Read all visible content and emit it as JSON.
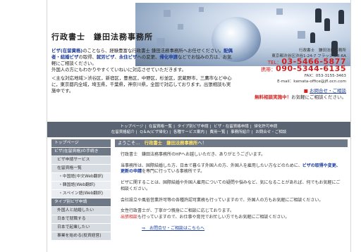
{
  "header": {
    "title": "行政書士　鎌田法務事務所",
    "intro": {
      "p1_a": "ビザ(在留資格)",
      "p1_b": "のことなら、経験豊富な行政書士 鎌田法務事務所へお任せください。",
      "p1_c": "配偶者・結婚ビザ",
      "p1_d": "の取得、",
      "p1_e": "就労ビザ",
      "p1_f": "、",
      "p1_g": "永住ビザ",
      "p1_h": "への変更、",
      "p1_i": "帰化申請",
      "p1_j": "などでお悩みの方は、お気軽にご相談ください。",
      "p1_k": "外国人の方にもわかりやすくていねいに対応させていただきます。",
      "p2": "＜主な対応地域＞渋谷区，新宿区，豊島区，中野区，杉並区，武蔵野市，三鷹市など中心に，東京都内全域，埼玉県，千葉県，神奈川県，全国で対応しております。出張相談も実施中です。"
    },
    "contact": {
      "office_line1": "行政書士　鎌田法務事務所",
      "office_line2": "東京都渋谷区渋谷1-24-7 フラッシュ8-6A",
      "tel_label": "TEL：",
      "tel": "03-5466-5877",
      "mobile_label": "携帯：",
      "mobile": "090-5344-6135",
      "fax": "FAX：053-3155-3463",
      "email": "E-mail：kamata-office@jfl.ocn.com",
      "inquiry": "お問合せ・ご相談",
      "free_label": "無料相談実施中！",
      "free_text": "お気軽にご相談ください。"
    }
  },
  "nav": {
    "row1": [
      "トップページ",
      "在留資格一覧",
      "タイプ別ビザ申請",
      "ビザ・在留資格申請",
      "帰化許可申請"
    ],
    "row2": [
      "在留資格紹介",
      "Q＆A(ビザ帰化)",
      "各種サービス案内",
      "費用一覧",
      "事務所紹介",
      "お問合せ・ご相談"
    ]
  },
  "sidebar": {
    "items": [
      {
        "label": "トップページ",
        "kind": "head"
      },
      {
        "label": "ビザ(在留資格)の手続き",
        "kind": "head"
      },
      {
        "label": "ビザ申請サービス",
        "kind": "sub"
      },
      {
        "label": "在留資格一覧",
        "kind": "sub"
      },
      {
        "label": "・中国語(中文Web翻訳)",
        "kind": "sub2"
      },
      {
        "label": "・韓国語(Web翻訳)",
        "kind": "sub2"
      },
      {
        "label": "・スペイン語(Web翻訳)",
        "kind": "sub2"
      },
      {
        "label": "タイプ別ビザ申請",
        "kind": "head"
      },
      {
        "label": "外国人と結婚したい",
        "kind": "sub"
      },
      {
        "label": "日本で就職する",
        "kind": "sub"
      },
      {
        "label": "日本で起業したい",
        "kind": "sub"
      },
      {
        "label": "事業を始める(投資経営)",
        "kind": "sub"
      }
    ]
  },
  "main": {
    "welcome_a": "ようこそ…　",
    "welcome_b": "行政書士　鎌田法務事務所",
    "welcome_c": "へ！",
    "p1": "行政書士　鎌田法務事務所のHPへお越しいただき、ありがとうございます。",
    "p2_a": "当事務所は、国際結婚した方、日本で暮らす外国人の方、外国人を雇用したい方などのために、",
    "p2_b": "ビザの取得や変更、更新の申請",
    "p2_c": "を専門に行っている事務所です。",
    "p3": "ビザに関することは、国際結婚や外国人雇用についての疑問や悩みなど、気になることがあれば、何でもお気軽にご相談ください。",
    "p4": "会社設立や風俗営業許可等の各種許認可業務も行っていますので、外国人の方もお気軽にご相談ください。",
    "p5": "女性行政書士が、丁寧かつ親身にご相談に応じております。",
    "p6_a": "出張相談",
    "p6_b": "も行っていますので、お仕事や育児でお忙しい方でもお気軽にご相談ください。",
    "link": "⇒　お問合せ・ご相談はこちらへ"
  }
}
